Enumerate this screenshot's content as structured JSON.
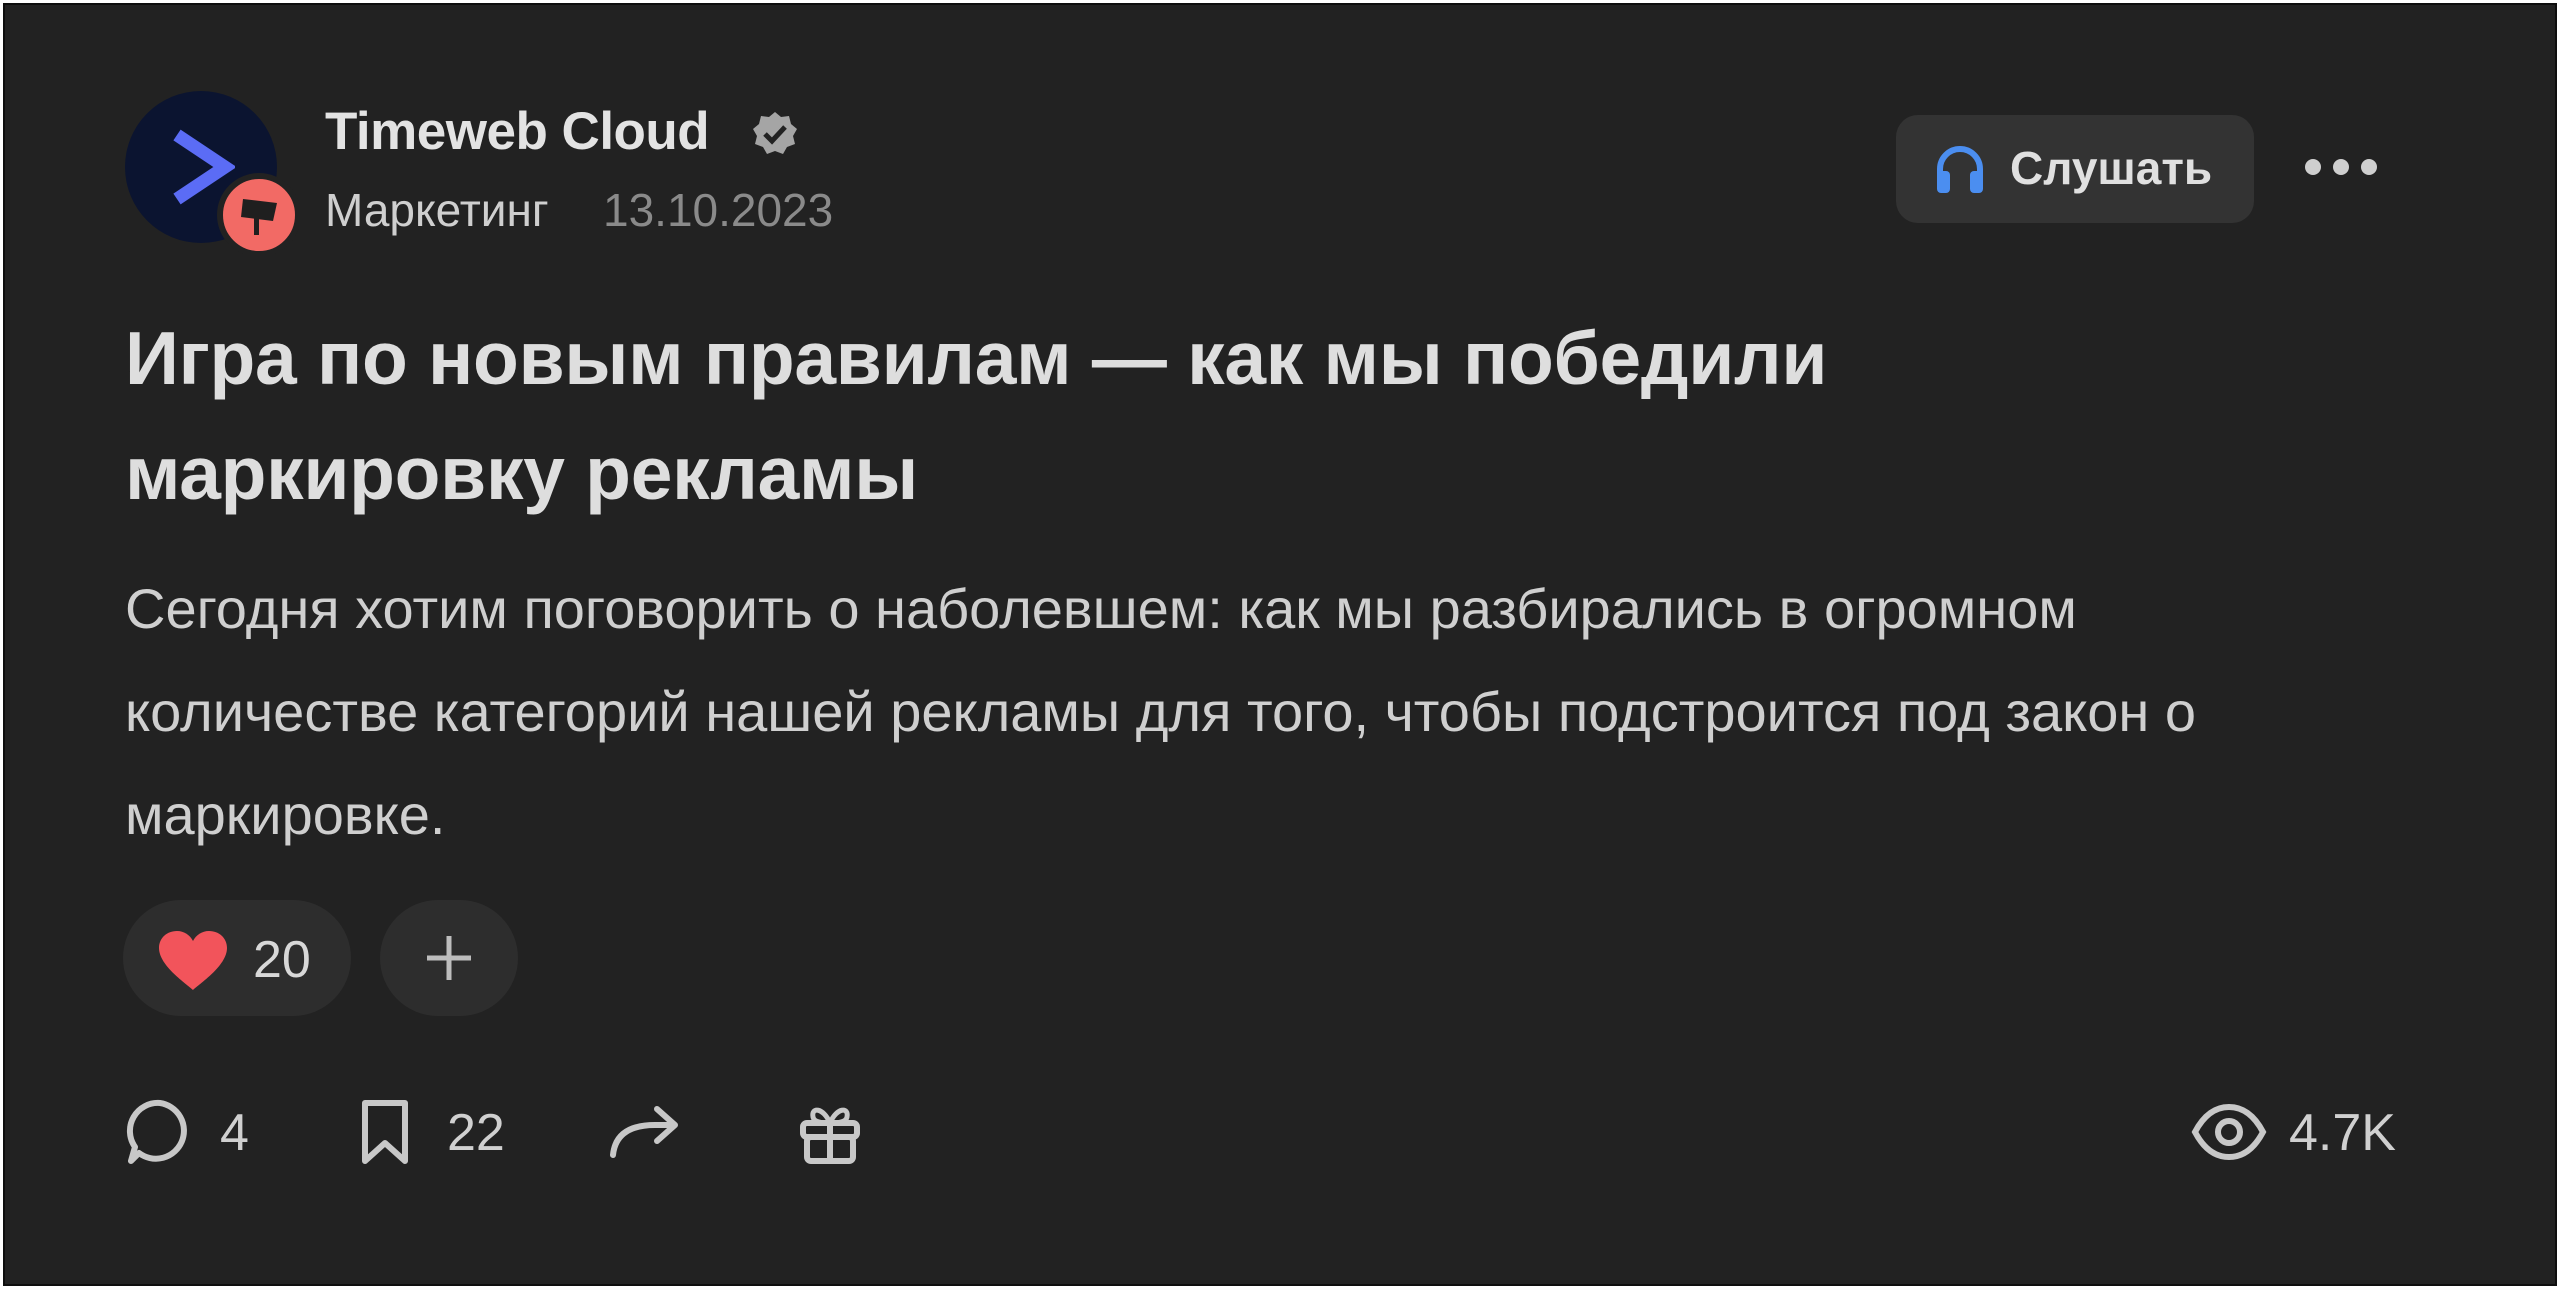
{
  "post": {
    "author": "Timeweb Cloud",
    "category": "Маркетинг",
    "date": "13.10.2023",
    "title": "Игра по новым правилам — как мы победили маркировку рекламы",
    "lead": "Сегодня хотим поговорить о наболевшем: как мы разбирались в огромном количестве категорий нашей рекламы для того, чтобы подстроится под закон о маркировке."
  },
  "header": {
    "listen_label": "Слушать",
    "avatar_icon": "chevron-right-icon",
    "badge_icon": "billboard-icon",
    "verified_icon": "verified-check-icon",
    "more_icon": "more-horizontal-icon"
  },
  "reactions": {
    "heart_count": "20",
    "heart_icon": "heart-icon",
    "add_icon": "plus-icon"
  },
  "footer": {
    "comments_count": "4",
    "bookmarks_count": "22",
    "views_count": "4.7K",
    "icons": [
      "comment-icon",
      "bookmark-icon",
      "share-icon",
      "gift-icon",
      "eye-icon"
    ]
  },
  "colors": {
    "background": "#222222",
    "text_primary": "#dedede",
    "text_muted": "#8a8a8a",
    "avatar_bg": "#0b1430",
    "avatar_accent": "#5b6cf5",
    "badge_bg": "#f26a65",
    "listen_icon": "#4b8ef0",
    "heart": "#f2545b"
  }
}
